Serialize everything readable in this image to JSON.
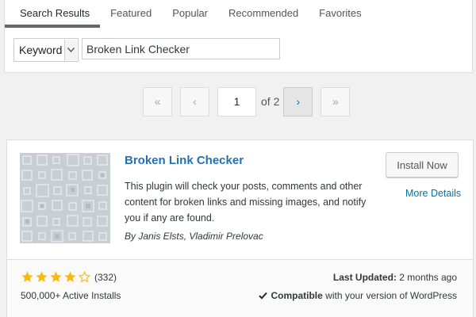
{
  "tabs": [
    {
      "label": "Search Results",
      "active": true
    },
    {
      "label": "Featured",
      "active": false
    },
    {
      "label": "Popular",
      "active": false
    },
    {
      "label": "Recommended",
      "active": false
    },
    {
      "label": "Favorites",
      "active": false
    }
  ],
  "search": {
    "type_selected": "Keyword",
    "query": "Broken Link Checker"
  },
  "pagination": {
    "first": "«",
    "prev": "‹",
    "current_page": "1",
    "of_text": "of 2",
    "next": "›",
    "last": "»"
  },
  "plugin": {
    "name": "Broken Link Checker",
    "description": "This plugin will check your posts, comments and other content for broken links and missing images, and notify you if any are found.",
    "authors": "By Janis Elsts, Vladimir Prelovac",
    "install_label": "Install Now",
    "more_details_label": "More Details",
    "rating_stars": 4,
    "rating_count": "(332)",
    "active_installs": "500,000+ Active Installs",
    "last_updated_label": "Last Updated:",
    "last_updated_value": "2 months ago",
    "compat_strong": "Compatible",
    "compat_rest": "with your version of WordPress"
  },
  "colors": {
    "link": "#0073aa",
    "star": "#ffb900",
    "thumb_bg": "#c8cfd4"
  },
  "icons": {
    "select_arrow": "chevron-down-icon",
    "star": "star-icon",
    "check": "checkmark-icon"
  }
}
